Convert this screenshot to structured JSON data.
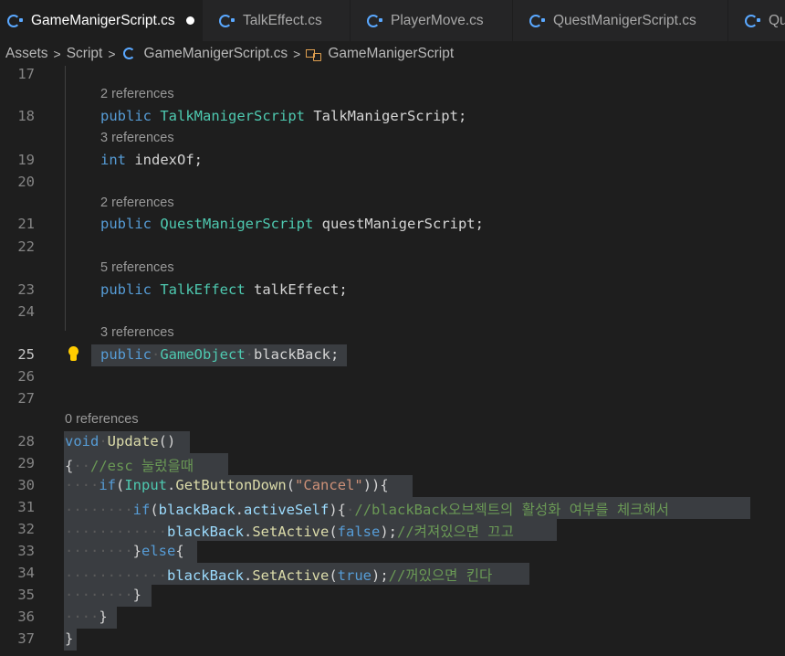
{
  "tabs": [
    {
      "label": "GameManigerScript.cs",
      "modified": true,
      "active": true
    },
    {
      "label": "TalkEffect.cs"
    },
    {
      "label": "PlayerMove.cs"
    },
    {
      "label": "QuestManigerScript.cs"
    },
    {
      "label": "Qu"
    }
  ],
  "breadcrumb": {
    "items": [
      "Assets",
      "Script",
      "GameManigerScript.cs",
      "GameManigerScript"
    ],
    "separator": ">"
  },
  "editor": {
    "current_line": "25",
    "lines": {
      "l17": "17",
      "l18": "18",
      "l19": "19",
      "l20": "20",
      "l21": "21",
      "l22": "22",
      "l23": "23",
      "l24": "24",
      "l25": "25",
      "l26": "26",
      "l27": "27",
      "l28": "28",
      "l29": "29",
      "l30": "30",
      "l31": "31",
      "l32": "32",
      "l33": "33",
      "l34": "34",
      "l35": "35",
      "l36": "36",
      "l37": "37"
    },
    "codelens": {
      "r18": "2 references",
      "r19": "3 references",
      "r21": "2 references",
      "r23": "5 references",
      "r25": "3 references",
      "r28": "0 references"
    },
    "tokens": {
      "public": "public",
      "int": "int",
      "void": "void",
      "if": "if",
      "else": "else",
      "false": "false",
      "true": "true",
      "TalkManigerScript": "TalkManigerScript",
      "talkManigerScriptVar": "TalkManigerScript;",
      "indexOf": "indexOf;",
      "QuestManigerScript": "QuestManigerScript",
      "questManigerScriptVar": "questManigerScript;",
      "TalkEffect": "TalkEffect",
      "talkEffectVar": "talkEffect;",
      "GameObject": "GameObject",
      "blackBackDecl": "blackBack;",
      "Update": "Update",
      "Input": "Input",
      "GetButtonDown": "GetButtonDown",
      "cancelStr": "\"Cancel\"",
      "blackBack": "blackBack",
      "activeSelf": "activeSelf",
      "SetActive": "SetActive",
      "c29": "//esc 눌렀을때",
      "c31": "//blackBack오브젝트의 활성화 여부를 체크해서",
      "c32": "//켜져있으면 끄고",
      "c34": "//꺼있으면 킨다"
    }
  }
}
